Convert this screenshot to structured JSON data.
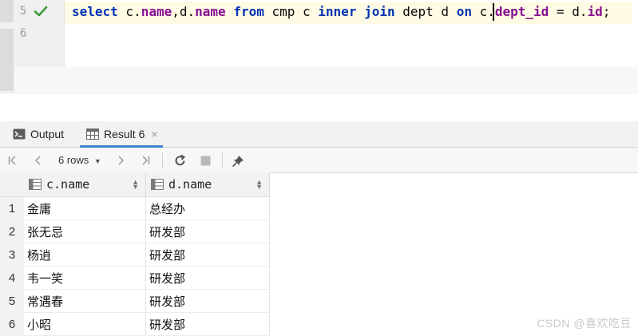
{
  "editor": {
    "lines": [
      {
        "number": "5",
        "status": "check-icon"
      },
      {
        "number": "6"
      }
    ],
    "code_tokens": [
      {
        "t": "select",
        "c": "kw"
      },
      {
        "t": " c.",
        "c": ""
      },
      {
        "t": "name",
        "c": "fld"
      },
      {
        "t": ",d.",
        "c": ""
      },
      {
        "t": "name",
        "c": "fld"
      },
      {
        "t": " ",
        "c": ""
      },
      {
        "t": "from",
        "c": "kw"
      },
      {
        "t": " cmp c ",
        "c": ""
      },
      {
        "t": "inner",
        "c": "kw"
      },
      {
        "t": " ",
        "c": ""
      },
      {
        "t": "join",
        "c": "kw"
      },
      {
        "t": " dept d ",
        "c": ""
      },
      {
        "t": "on",
        "c": "kw"
      },
      {
        "t": " c.",
        "c": ""
      },
      {
        "t": "dept_id",
        "c": "fld"
      },
      {
        "t": " = d.",
        "c": ""
      },
      {
        "t": "id",
        "c": "fld"
      },
      {
        "t": ";",
        "c": ""
      }
    ],
    "colors": {
      "keyword": "#0033b3",
      "field": "#871094",
      "check": "#3c9b3c",
      "current_line": "#fffae3"
    }
  },
  "tabs": {
    "output_label": "Output",
    "result_label": "Result 6",
    "result_close": "×"
  },
  "toolbar": {
    "rows_label": "6 rows",
    "icons": [
      "first-page-icon",
      "prev-page-icon",
      "rows-dropdown-icon",
      "next-page-icon",
      "last-page-icon",
      "refresh-icon",
      "stop-icon",
      "pin-icon"
    ]
  },
  "grid": {
    "columns": [
      "c.name",
      "d.name"
    ],
    "rows": [
      {
        "num": "1",
        "c_name": "金庸",
        "d_name": "总经办"
      },
      {
        "num": "2",
        "c_name": "张无忌",
        "d_name": "研发部"
      },
      {
        "num": "3",
        "c_name": "杨逍",
        "d_name": "研发部"
      },
      {
        "num": "4",
        "c_name": "韦一笑",
        "d_name": "研发部"
      },
      {
        "num": "5",
        "c_name": "常遇春",
        "d_name": "研发部"
      },
      {
        "num": "6",
        "c_name": "小昭",
        "d_name": "研发部"
      }
    ]
  },
  "watermark": "CSDN @喜欢吃豆"
}
